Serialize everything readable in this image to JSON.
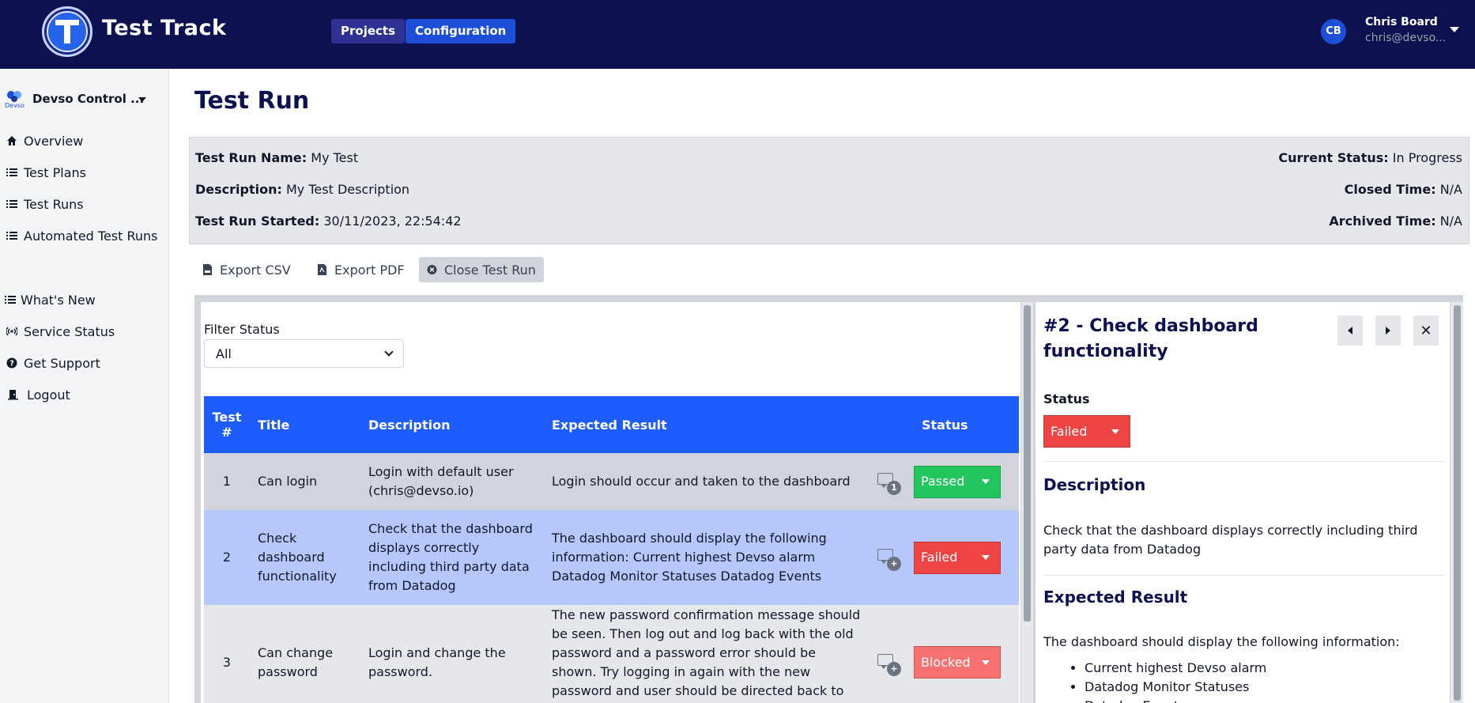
{
  "app": {
    "title": "Test Track",
    "nav": {
      "projects": "Projects",
      "configuration": "Configuration"
    },
    "user": {
      "initials": "CB",
      "name": "Chris Board",
      "email": "chris@devso..."
    }
  },
  "sidebar": {
    "org_logo_text": "Devso",
    "org_name": "Devso Control ...",
    "items": [
      {
        "label": "Overview",
        "icon": "home-icon"
      },
      {
        "label": "Test Plans",
        "icon": "list-icon"
      },
      {
        "label": "Test Runs",
        "icon": "list-icon"
      },
      {
        "label": "Automated Test Runs",
        "icon": "list-icon"
      }
    ],
    "secondary": [
      {
        "label": "What's New",
        "icon": "list-icon"
      },
      {
        "label": "Service Status",
        "icon": "broadcast-icon"
      },
      {
        "label": "Get Support",
        "icon": "question-circle-icon"
      },
      {
        "label": "Logout",
        "icon": "door-icon"
      }
    ]
  },
  "page": {
    "title": "Test Run",
    "info": {
      "name_label": "Test Run Name:",
      "name": "My Test",
      "desc_label": "Description:",
      "desc": "My Test Description",
      "started_label": "Test Run Started:",
      "started": "30/11/2023, 22:54:42",
      "status_label": "Current Status:",
      "status": "In Progress",
      "closed_label": "Closed Time:",
      "closed": "N/A",
      "archived_label": "Archived Time:",
      "archived": "N/A"
    },
    "toolbar": {
      "export_csv": "Export CSV",
      "export_pdf": "Export PDF",
      "close_run": "Close Test Run"
    }
  },
  "filter": {
    "label": "Filter Status",
    "selected": "All"
  },
  "table": {
    "headers": [
      "Test #",
      "Title",
      "Description",
      "Expected Result",
      "Status"
    ],
    "rows": [
      {
        "num": "1",
        "title": "Can login",
        "description": "Login with default user (chris@devso.io)",
        "expected": "Login should occur and taken to the dashboard",
        "comments": "1",
        "status": "Passed"
      },
      {
        "num": "2",
        "title": "Check dashboard functionality",
        "description": "Check that the dashboard displays correctly including third party data from Datadog",
        "expected": "The dashboard should display the following information: Current highest Devso alarm Datadog Monitor Statuses Datadog Events",
        "comments": "+",
        "status": "Failed"
      },
      {
        "num": "3",
        "title": "Can change password",
        "description": "Login and change the password.",
        "expected": "The new password confirmation message should be seen. Then log out and log back with the old password and a password error should be shown. Try logging in again with the new password and user should be directed back to the dashboard.",
        "comments": "+",
        "status": "Blocked"
      }
    ]
  },
  "detail": {
    "title": "#2 - Check dashboard functionality",
    "status_label": "Status",
    "status": "Failed",
    "description_heading": "Description",
    "description": "Check that the dashboard displays correctly including third party data from Datadog",
    "expected_heading": "Expected Result",
    "expected_intro": "The dashboard should display the following information:",
    "expected_items": [
      "Current highest Devso alarm",
      "Datadog Monitor Statuses",
      "Datadog Events"
    ]
  },
  "colors": {
    "header_bg": "#0e1150",
    "accent": "#1d5cff",
    "passed": "#22c55e",
    "failed": "#ef4444",
    "blocked": "#f87171"
  }
}
